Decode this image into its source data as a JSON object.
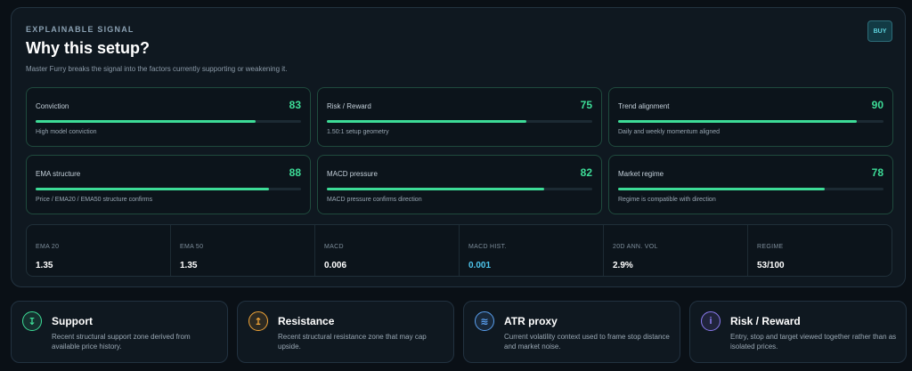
{
  "header": {
    "eyebrow": "EXPLAINABLE SIGNAL",
    "title": "Why this setup?",
    "subtitle": "Master Furry breaks the signal into the factors currently supporting or weakening it.",
    "badge": "BUY"
  },
  "factors": [
    {
      "name": "Conviction",
      "score": "83",
      "level": 0.83,
      "description": "High model conviction"
    },
    {
      "name": "Risk / Reward",
      "score": "75",
      "level": 0.75,
      "description": "1.50:1 setup geometry"
    },
    {
      "name": "Trend alignment",
      "score": "90",
      "level": 0.9,
      "description": "Daily and weekly momentum aligned"
    },
    {
      "name": "EMA structure",
      "score": "88",
      "level": 0.88,
      "description": "Price / EMA20 / EMA50 structure confirms"
    },
    {
      "name": "MACD pressure",
      "score": "82",
      "level": 0.82,
      "description": "MACD pressure confirms direction"
    },
    {
      "name": "Market regime",
      "score": "78",
      "level": 0.78,
      "description": "Regime is compatible with direction"
    }
  ],
  "metrics": [
    {
      "label": "EMA 20",
      "value": "1.35"
    },
    {
      "label": "EMA 50",
      "value": "1.35"
    },
    {
      "label": "MACD",
      "value": "0.006"
    },
    {
      "label": "MACD HIST.",
      "value": "0.001"
    },
    {
      "label": "20D ANN. VOL",
      "value": "2.9%"
    },
    {
      "label": "REGIME",
      "value": "53/100"
    }
  ],
  "cards": [
    {
      "title": "Support",
      "description": "Recent structural support zone derived from available price history.",
      "icon": "support-icon",
      "glyph": "↧",
      "color": "#3ddc97"
    },
    {
      "title": "Resistance",
      "description": "Recent structural resistance zone that may cap upside.",
      "icon": "resistance-icon",
      "glyph": "↥",
      "color": "#f0a437"
    },
    {
      "title": "ATR proxy",
      "description": "Current volatility context used to frame stop distance and market noise.",
      "icon": "waves-icon",
      "glyph": "≋",
      "color": "#5aa0f0"
    },
    {
      "title": "Risk / Reward",
      "description": "Entry, stop and target viewed together rather than as isolated prices.",
      "icon": "info-icon",
      "glyph": "i",
      "color": "#8b7bf0"
    }
  ],
  "colors": {
    "accent": "#3ddc97",
    "highlight": "#4ec6ee",
    "badge": "#5fd3de"
  }
}
